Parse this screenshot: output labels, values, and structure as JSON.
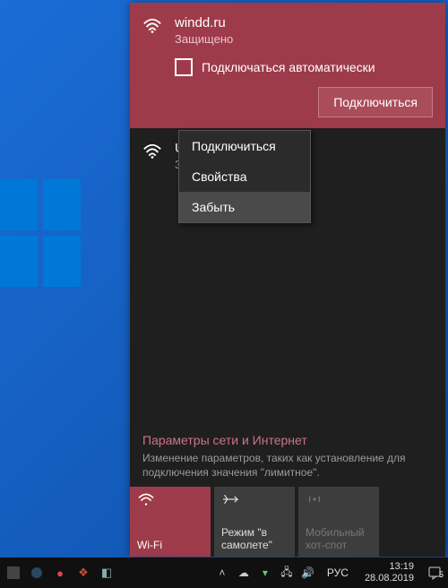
{
  "selected_network": {
    "name": "windd.ru",
    "status": "Защищено",
    "auto_connect_label": "Подключаться автоматически",
    "connect_button": "Подключиться"
  },
  "other_network": {
    "name": "UKr",
    "status": "Защ"
  },
  "context_menu": {
    "items": [
      "Подключиться",
      "Свойства",
      "Забыть"
    ],
    "hover_index": 2
  },
  "settings": {
    "title": "Параметры сети и Интернет",
    "description": "Изменение параметров, таких как установление для подключения значения \"лимитное\"."
  },
  "tiles": [
    {
      "label": "Wi-Fi",
      "icon": "wifi",
      "state": "active"
    },
    {
      "label": "Режим \"в самолете\"",
      "icon": "airplane",
      "state": "normal"
    },
    {
      "label": "Мобильный хот-спот",
      "icon": "hotspot",
      "state": "disabled"
    }
  ],
  "taskbar": {
    "lang": "РУС",
    "time": "13:19",
    "date": "28.08.2019",
    "notif_count": "5"
  },
  "colors": {
    "accent": "#9e3b4a",
    "panel": "#1f1f1f"
  }
}
